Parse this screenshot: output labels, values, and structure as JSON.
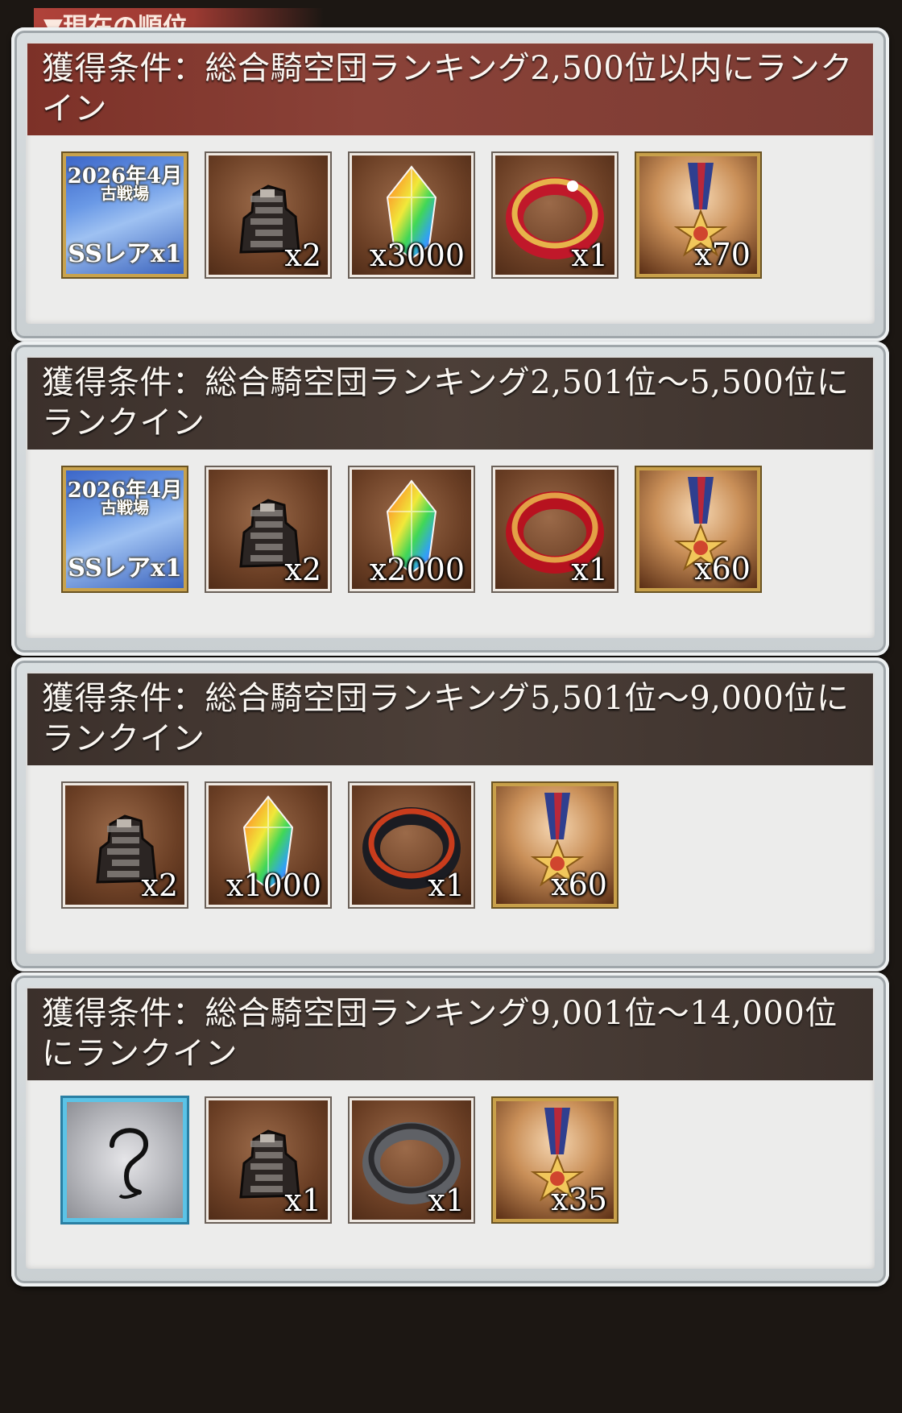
{
  "current_rank_tab": {
    "label": "▼現在の順位"
  },
  "tiers": [
    {
      "condition": "獲得条件：総合騎空団ランキング2,500位以内にランクイン",
      "header_style": "red",
      "items": [
        {
          "kind": "ticket",
          "ticket_line1": "2026年4月",
          "ticket_line2": "古戦場",
          "ticket_line3": "SSレアx1",
          "count": ""
        },
        {
          "kind": "ore",
          "count": "x2"
        },
        {
          "kind": "crystal",
          "count": "x3000"
        },
        {
          "kind": "ring-gold",
          "count": "x1"
        },
        {
          "kind": "medal",
          "count": "x70"
        }
      ]
    },
    {
      "condition": "獲得条件：総合騎空団ランキング2,501位〜5,500位にランクイン",
      "header_style": "dark",
      "items": [
        {
          "kind": "ticket",
          "ticket_line1": "2026年4月",
          "ticket_line2": "古戦場",
          "ticket_line3": "SSレアx1",
          "count": ""
        },
        {
          "kind": "ore",
          "count": "x2"
        },
        {
          "kind": "crystal",
          "count": "x2000"
        },
        {
          "kind": "ring-red",
          "count": "x1"
        },
        {
          "kind": "medal",
          "count": "x60"
        }
      ]
    },
    {
      "condition": "獲得条件：総合騎空団ランキング5,501位〜9,000位にランクイン",
      "header_style": "dark",
      "items": [
        {
          "kind": "ore",
          "count": "x2"
        },
        {
          "kind": "crystal",
          "count": "x1000"
        },
        {
          "kind": "ring-black",
          "count": "x1"
        },
        {
          "kind": "medal",
          "count": "x60"
        }
      ]
    },
    {
      "condition": "獲得条件：総合騎空団ランキング9,001位〜14,000位にランクイン",
      "header_style": "dark",
      "items": [
        {
          "kind": "mystery",
          "count": ""
        },
        {
          "kind": "ore",
          "count": "x1"
        },
        {
          "kind": "ring-silver",
          "count": "x1"
        },
        {
          "kind": "medal",
          "count": "x35"
        }
      ]
    }
  ],
  "colors": {
    "header_red": "#7d3128",
    "header_dark": "#3b302b",
    "mystery_frame": "#5cc3e6"
  }
}
